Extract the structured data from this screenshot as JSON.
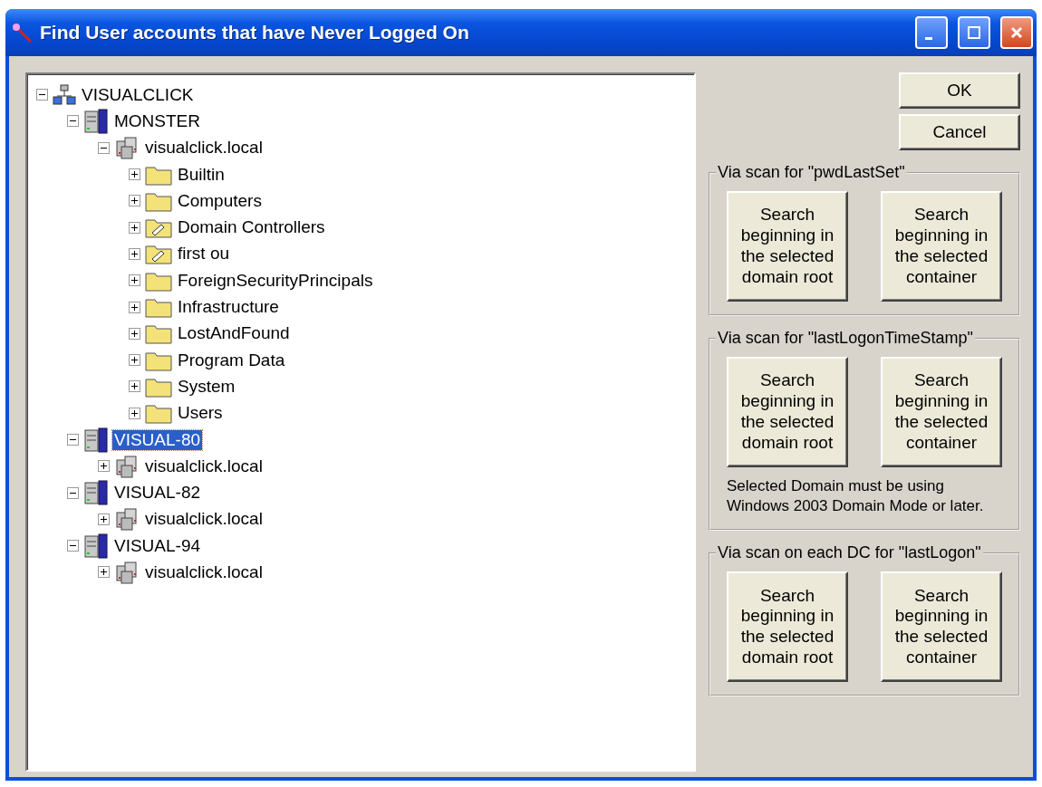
{
  "window": {
    "title": "Find User accounts that have Never Logged On"
  },
  "tree": [
    {
      "label": "VISUALCLICK",
      "kind": "network",
      "expanded": true,
      "selected": false,
      "children": [
        {
          "label": "MONSTER",
          "kind": "server",
          "expanded": true,
          "selected": false,
          "children": [
            {
              "label": "visualclick.local",
              "kind": "domain",
              "expanded": true,
              "selected": false,
              "children": [
                {
                  "label": "Builtin",
                  "kind": "folder",
                  "expanded": false,
                  "selected": false
                },
                {
                  "label": "Computers",
                  "kind": "folder",
                  "expanded": false,
                  "selected": false
                },
                {
                  "label": "Domain Controllers",
                  "kind": "ou",
                  "expanded": false,
                  "selected": false
                },
                {
                  "label": "first ou",
                  "kind": "ou",
                  "expanded": false,
                  "selected": false
                },
                {
                  "label": "ForeignSecurityPrincipals",
                  "kind": "folder",
                  "expanded": false,
                  "selected": false
                },
                {
                  "label": "Infrastructure",
                  "kind": "folder",
                  "expanded": false,
                  "selected": false
                },
                {
                  "label": "LostAndFound",
                  "kind": "folder",
                  "expanded": false,
                  "selected": false
                },
                {
                  "label": "Program Data",
                  "kind": "folder",
                  "expanded": false,
                  "selected": false
                },
                {
                  "label": "System",
                  "kind": "folder",
                  "expanded": false,
                  "selected": false
                },
                {
                  "label": "Users",
                  "kind": "folder",
                  "expanded": false,
                  "selected": false
                }
              ]
            }
          ]
        },
        {
          "label": "VISUAL-80",
          "kind": "server",
          "expanded": true,
          "selected": true,
          "children": [
            {
              "label": "visualclick.local",
              "kind": "domain",
              "expanded": false,
              "selected": false
            }
          ]
        },
        {
          "label": "VISUAL-82",
          "kind": "server",
          "expanded": true,
          "selected": false,
          "children": [
            {
              "label": "visualclick.local",
              "kind": "domain",
              "expanded": false,
              "selected": false
            }
          ]
        },
        {
          "label": "VISUAL-94",
          "kind": "server",
          "expanded": true,
          "selected": false,
          "children": [
            {
              "label": "visualclick.local",
              "kind": "domain",
              "expanded": false,
              "selected": false
            }
          ]
        }
      ]
    }
  ],
  "buttons": [
    "OK",
    "Cancel"
  ],
  "groups": [
    {
      "legend": "Via scan for \"pwdLastSet\"",
      "buttons": [
        "Search beginning in the selected domain root",
        "Search beginning in the selected container"
      ]
    },
    {
      "legend": "Via scan for \"lastLogonTimeStamp\"",
      "buttons": [
        "Search beginning in the selected domain root",
        "Search beginning in the selected container"
      ],
      "note": "Selected Domain must be using Windows 2003 Domain Mode or later."
    },
    {
      "legend": "Via scan on each DC for \"lastLogon\"",
      "buttons": [
        "Search beginning in the selected domain root",
        "Search beginning in the selected container"
      ]
    }
  ]
}
